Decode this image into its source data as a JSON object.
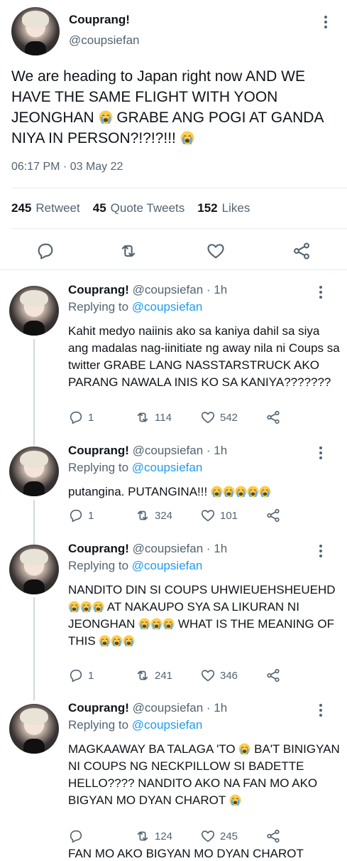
{
  "main_tweet": {
    "name": "Couprang!",
    "handle": "@coupsiefan",
    "text_1": "We are heading to Japan right now AND WE HAVE THE SAME FLIGHT WITH YOON JEONGHAN ",
    "text_2": " GRABE ANG POGI AT GANDA NIYA IN PERSON?!?!?!!! ",
    "emoji_name": "loudly-crying-face-emoji",
    "timestamp": "06:17 PM · 03 May 22",
    "stats": {
      "retweets_count": "245",
      "retweets_label": "Retweet",
      "quotes_count": "45",
      "quotes_label": "Quote Tweets",
      "likes_count": "152",
      "likes_label": "Likes"
    },
    "actions": [
      "reply-icon",
      "retweet-icon",
      "like-icon",
      "share-icon"
    ]
  },
  "replies": [
    {
      "name": "Couprang!",
      "handle_time": "@coupsiefan · 1h",
      "replying_prefix": "Replying to",
      "replying_to": "@coupsiefan",
      "text": "Kahit medyo naiinis ako sa kaniya dahil sa siya ang madalas nag-iinitiate ng away nila ni Coups sa twitter GRABE LANG NASSTARSTRUCK AKO PARANG NAWALA INIS KO SA KANIYA???????",
      "replies": "1",
      "retweets": "114",
      "likes": "542"
    },
    {
      "name": "Couprang!",
      "handle_time": "@coupsiefan · 1h",
      "replying_prefix": "Replying to",
      "replying_to": "@coupsiefan",
      "text": "putangina. PUTANGINA!!! ",
      "replies": "1",
      "retweets": "324",
      "likes": "101"
    },
    {
      "name": "Couprang!",
      "handle_time": "@coupsiefan · 1h",
      "replying_prefix": "Replying to",
      "replying_to": "@coupsiefan",
      "text_a": "NANDITO DIN SI COUPS UHWIEUEHSHEUEHD ",
      "text_b": " AT NAKAUPO SYA SA LIKURAN NI JEONGHAN ",
      "text_c": " WHAT IS THE MEANING OF THIS ",
      "replies": "1",
      "retweets": "241",
      "likes": "346"
    },
    {
      "name": "Couprang!",
      "handle_time": "@coupsiefan · 1h",
      "replying_prefix": "Replying to",
      "replying_to": "@coupsiefan",
      "text_a": "MAGKAAWAY BA TALAGA 'TO ",
      "text_b": " BA'T BINIGYAN NI COUPS NG NECKPILLOW SI BADETTE HELLO???? NANDITO AKO NA FAN MO AKO BIGYAN MO DYAN CHAROT ",
      "retweets": "124",
      "likes": "245"
    }
  ],
  "cutoff_text": "FAN MO AKO BIGYAN MO DYAN CHAROT"
}
